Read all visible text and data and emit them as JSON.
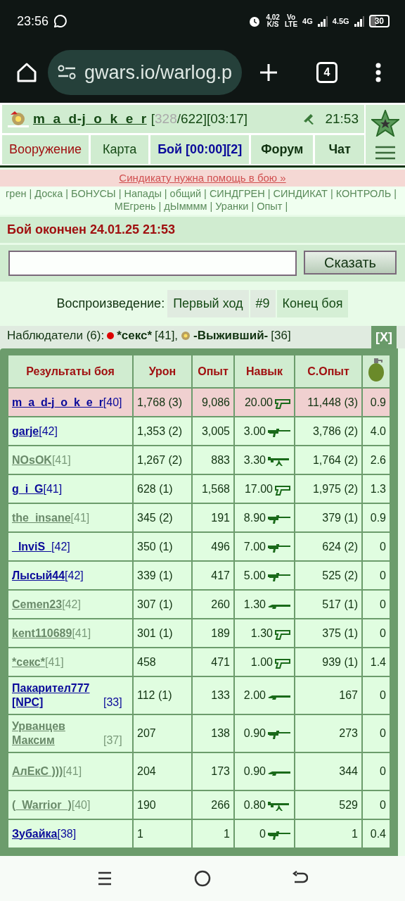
{
  "status_bar": {
    "time": "23:56",
    "speed": "4,02",
    "speed_unit": "K/S",
    "volte_top": "Vo",
    "volte_bottom": "LTE",
    "net1": "4G",
    "net2": "4.5G",
    "battery": "30"
  },
  "browser": {
    "url": "gwars.io/warlog.p",
    "tab_count": "4"
  },
  "header": {
    "user_name": "m_a_d-j_o_k_e_r",
    "stats_prefix": "[",
    "hp": "328",
    "stats_suffix": "/622][03:17]",
    "server_time": "21:53"
  },
  "tabs": [
    {
      "label": "Вооружение",
      "color": "#a01010",
      "bold": false
    },
    {
      "label": "Карта",
      "color": "#154a15",
      "bold": false
    },
    {
      "label": "Бой [00:00][2]",
      "color": "#0a0a9a",
      "bold": true
    },
    {
      "label": "Форум",
      "color": "#113311",
      "bold": true
    },
    {
      "label": "Чат",
      "color": "#113311",
      "bold": true
    }
  ],
  "banner": "Синдикату нужна помощь в бою »",
  "links": {
    "separator": "|",
    "items": [
      "грен",
      "Доска",
      "БОНУСЫ",
      "Напады",
      "общий",
      "СИНДГРЕН",
      "СИНДИКАТ",
      "КОНТРОЛЬ",
      "МЕгрень",
      "дЫмммм",
      "Уранки",
      "Опыт"
    ]
  },
  "battle_status": "Бой окончен 24.01.25 21:53",
  "chat": {
    "button": "Сказать"
  },
  "replay": {
    "label": "Воспроизведение:",
    "buttons": [
      "Первый ход",
      "#9",
      "Конец боя"
    ]
  },
  "observers": {
    "label": "Наблюдатели (6):",
    "people": [
      {
        "name": "*секс*",
        "level": "[41],",
        "kind": "dot"
      },
      {
        "name": "-Выживший-",
        "level": "[36]",
        "kind": "avatar"
      }
    ]
  },
  "results": {
    "close": "[X]",
    "columns": [
      "Результаты боя",
      "Урон",
      "Опыт",
      "Навык",
      "С.Опыт"
    ],
    "rows": [
      {
        "name": "m_a_d-j_o_k_e_r",
        "level": "[40]",
        "online": true,
        "highlighted": true,
        "damage": "1,768 (3)",
        "exp": "9,086",
        "skill": "20.00",
        "kind": "pistol",
        "total_exp": "11,448 (3)",
        "grenade": "0.9"
      },
      {
        "name": "garje",
        "level": "[42]",
        "online": true,
        "highlighted": false,
        "damage": "1,353 (2)",
        "exp": "3,005",
        "skill": "3.00",
        "kind": "rifle",
        "total_exp": "3,786 (2)",
        "grenade": "4.0"
      },
      {
        "name": "NOsOK",
        "level": "[41]",
        "online": false,
        "highlighted": false,
        "damage": "1,267 (2)",
        "exp": "883",
        "skill": "3.30",
        "kind": "machinegun",
        "total_exp": "1,764 (2)",
        "grenade": "2.6"
      },
      {
        "name": "g_i_G",
        "level": "[41]",
        "online": true,
        "highlighted": false,
        "damage": "628 (1)",
        "exp": "1,568",
        "skill": "17.00",
        "kind": "pistol",
        "total_exp": "1,975 (2)",
        "grenade": "1.3"
      },
      {
        "name": "the_insane",
        "level": "[41]",
        "online": false,
        "highlighted": false,
        "damage": "345 (2)",
        "exp": "191",
        "skill": "8.90",
        "kind": "rifle",
        "total_exp": "379 (1)",
        "grenade": "0.9"
      },
      {
        "name": "_InviS_",
        "level": "[42]",
        "online": true,
        "highlighted": false,
        "damage": "350 (1)",
        "exp": "496",
        "skill": "7.00",
        "kind": "rifle",
        "total_exp": "624 (2)",
        "grenade": "0"
      },
      {
        "name": "Лысый44",
        "level": "[42]",
        "online": true,
        "highlighted": false,
        "damage": "339 (1)",
        "exp": "417",
        "skill": "5.00",
        "kind": "rifle",
        "total_exp": "525 (2)",
        "grenade": "0"
      },
      {
        "name": "Cemen23",
        "level": "[42]",
        "online": false,
        "highlighted": false,
        "damage": "307 (1)",
        "exp": "260",
        "skill": "1.30",
        "kind": "shotgun",
        "total_exp": "517 (1)",
        "grenade": "0"
      },
      {
        "name": "kent110689",
        "level": "[41]",
        "online": false,
        "highlighted": false,
        "damage": "301 (1)",
        "exp": "189",
        "skill": "1.30",
        "kind": "pistol",
        "total_exp": "375 (1)",
        "grenade": "0"
      },
      {
        "name": "*секс*",
        "level": "[41]",
        "online": false,
        "highlighted": false,
        "damage": "458",
        "exp": "471",
        "skill": "1.00",
        "kind": "pistol",
        "total_exp": "939 (1)",
        "grenade": "1.4"
      },
      {
        "name": "Пакарител777 [NPC]",
        "level": "[33]",
        "online": true,
        "highlighted": false,
        "damage": "112 (1)",
        "exp": "133",
        "skill": "2.00",
        "kind": "shotgun",
        "total_exp": "167",
        "grenade": "0"
      },
      {
        "name": "Урванцев Максим",
        "level": "[37]",
        "online": false,
        "highlighted": false,
        "damage": "207",
        "exp": "138",
        "skill": "0.90",
        "kind": "rifle",
        "total_exp": "273",
        "grenade": "0"
      },
      {
        "name": "АлЕкС )))",
        "level": "[41]",
        "online": false,
        "highlighted": false,
        "damage": "204",
        "exp": "173",
        "skill": "0.90",
        "kind": "shotgun",
        "total_exp": "344",
        "grenade": "0"
      },
      {
        "name": "(_Warrior_)",
        "level": "[40]",
        "online": false,
        "highlighted": false,
        "damage": "190",
        "exp": "266",
        "skill": "0.80",
        "kind": "machinegun",
        "total_exp": "529",
        "grenade": "0"
      },
      {
        "name": "Зубайка",
        "level": "[38]",
        "online": true,
        "highlighted": false,
        "damage": "1",
        "exp": "1",
        "skill": "0",
        "kind": "rifle",
        "total_exp": "1",
        "grenade": "0.4"
      }
    ]
  }
}
